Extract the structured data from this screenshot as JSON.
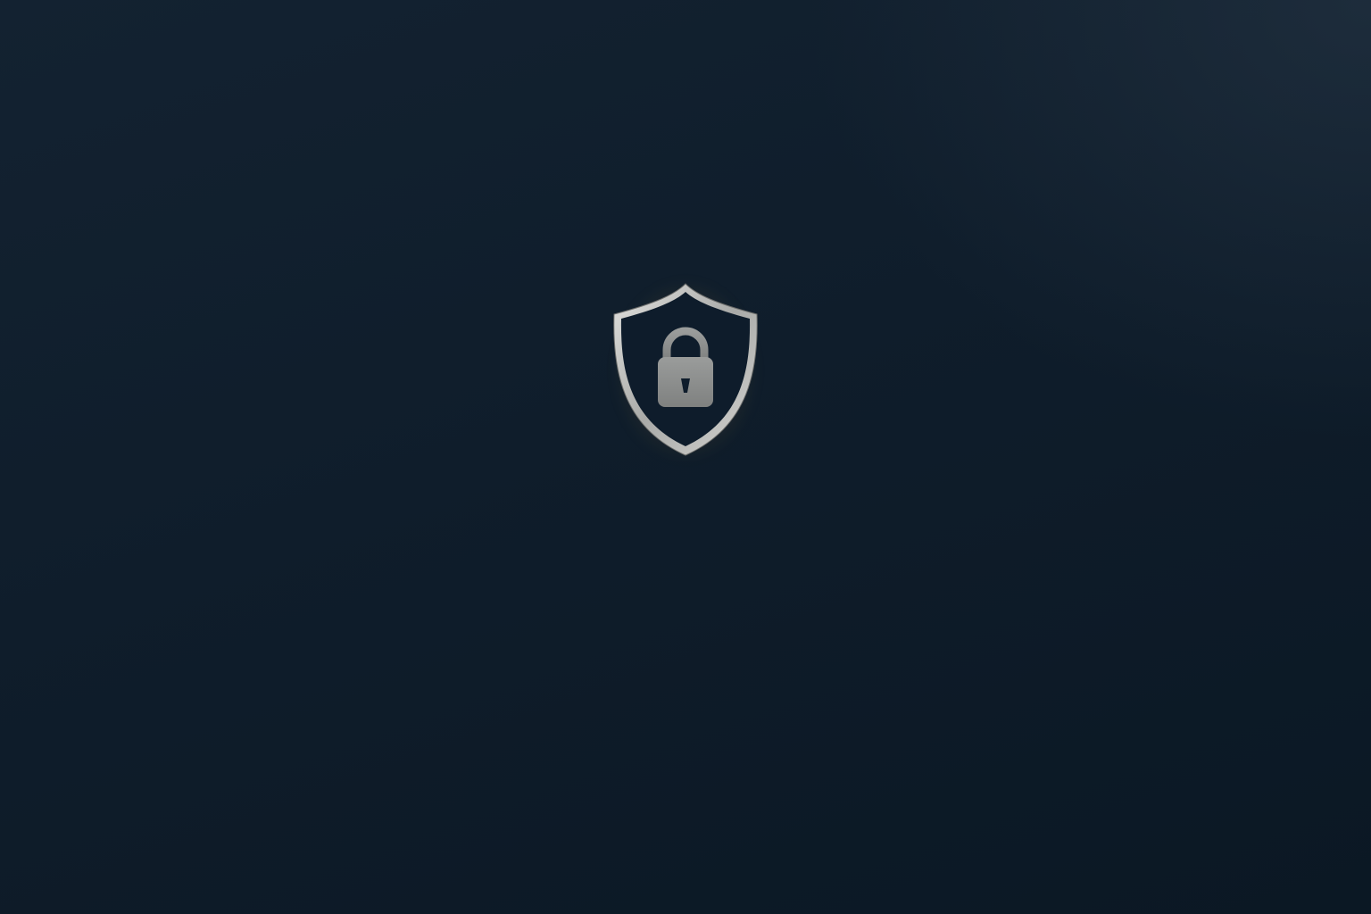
{
  "screen": {
    "background_color": "#0f1d2b",
    "emblem": {
      "icon": "shield-lock-icon",
      "shield_fill": "#0e1c2b",
      "shield_border": "#c9c9c7",
      "glow_color": "#c4963c",
      "lock_color": "#8c8e8d",
      "keyhole_color": "#0e1c2b"
    }
  }
}
